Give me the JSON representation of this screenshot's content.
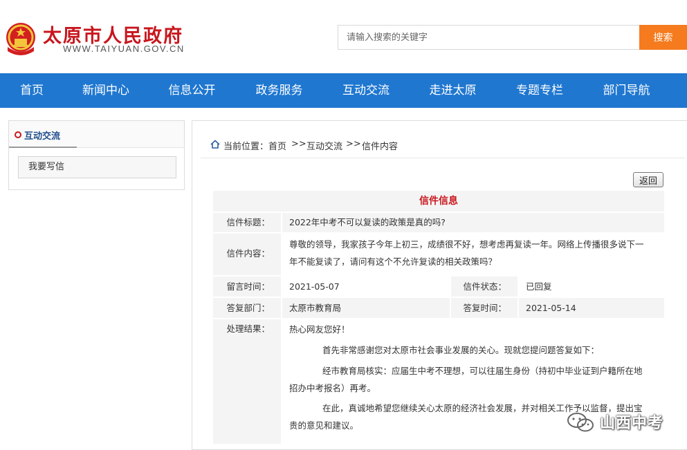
{
  "header": {
    "site_name": "太原市人民政府",
    "site_url": "WWW.TAIYUAN.GOV.CN",
    "search_placeholder": "请输入搜索的关键字",
    "search_button": "搜索"
  },
  "nav": {
    "items": [
      "首页",
      "新闻中心",
      "信息公开",
      "政务服务",
      "互动交流",
      "走进太原",
      "专题专栏",
      "部门导航"
    ]
  },
  "sidebar": {
    "title": "互动交流",
    "items": [
      "我要写信"
    ]
  },
  "breadcrumb": {
    "prefix": "当前位置：",
    "items": [
      "首页",
      "互动交流",
      "信件内容"
    ],
    "separator": ">>"
  },
  "back_button": "返回",
  "letter": {
    "section_title": "信件信息",
    "title_label": "信件标题：",
    "title_value": "2022年中考不可以复读的政策是真的吗?",
    "content_label": "信件内容：",
    "content_line1": "尊敬的领导，我家孩子今年上初三，成绩很不好，想考虑再复读一年。网络上传播很多说下一",
    "content_line2": "年不能复读了，请问有这个不允许复读的相关政策吗？",
    "time_label": "留言时间：",
    "time_value": "2021-05-07",
    "status_label": "信件状态：",
    "status_value": "已回复",
    "dept_label": "答复部门：",
    "dept_value": "太原市教育局",
    "reply_time_label": "答复时间：",
    "reply_time_value": "2021-05-14",
    "result_label": "处理结果：",
    "result_greeting": "热心网友您好！",
    "result_p1": "首先非常感谢您对太原市社会事业发展的关心。现就您提问题答复如下：",
    "result_p2_line1": "经市教育局核实：应届生中考不理想，可以往届生身份（持初中毕业证到户籍所在地",
    "result_p2_line2": "招办中考报名）再考。",
    "result_p3_line1": "在此，真诚地希望您继续关心太原的经济社会发展，并对相关工作予以监督，提出宝",
    "result_p3_line2": "贵的意见和建议。"
  },
  "watermark": {
    "text": "山西中考"
  },
  "colors": {
    "brand_red": "#c8161d",
    "nav_blue": "#1f77d0",
    "search_orange": "#f57b1e"
  }
}
